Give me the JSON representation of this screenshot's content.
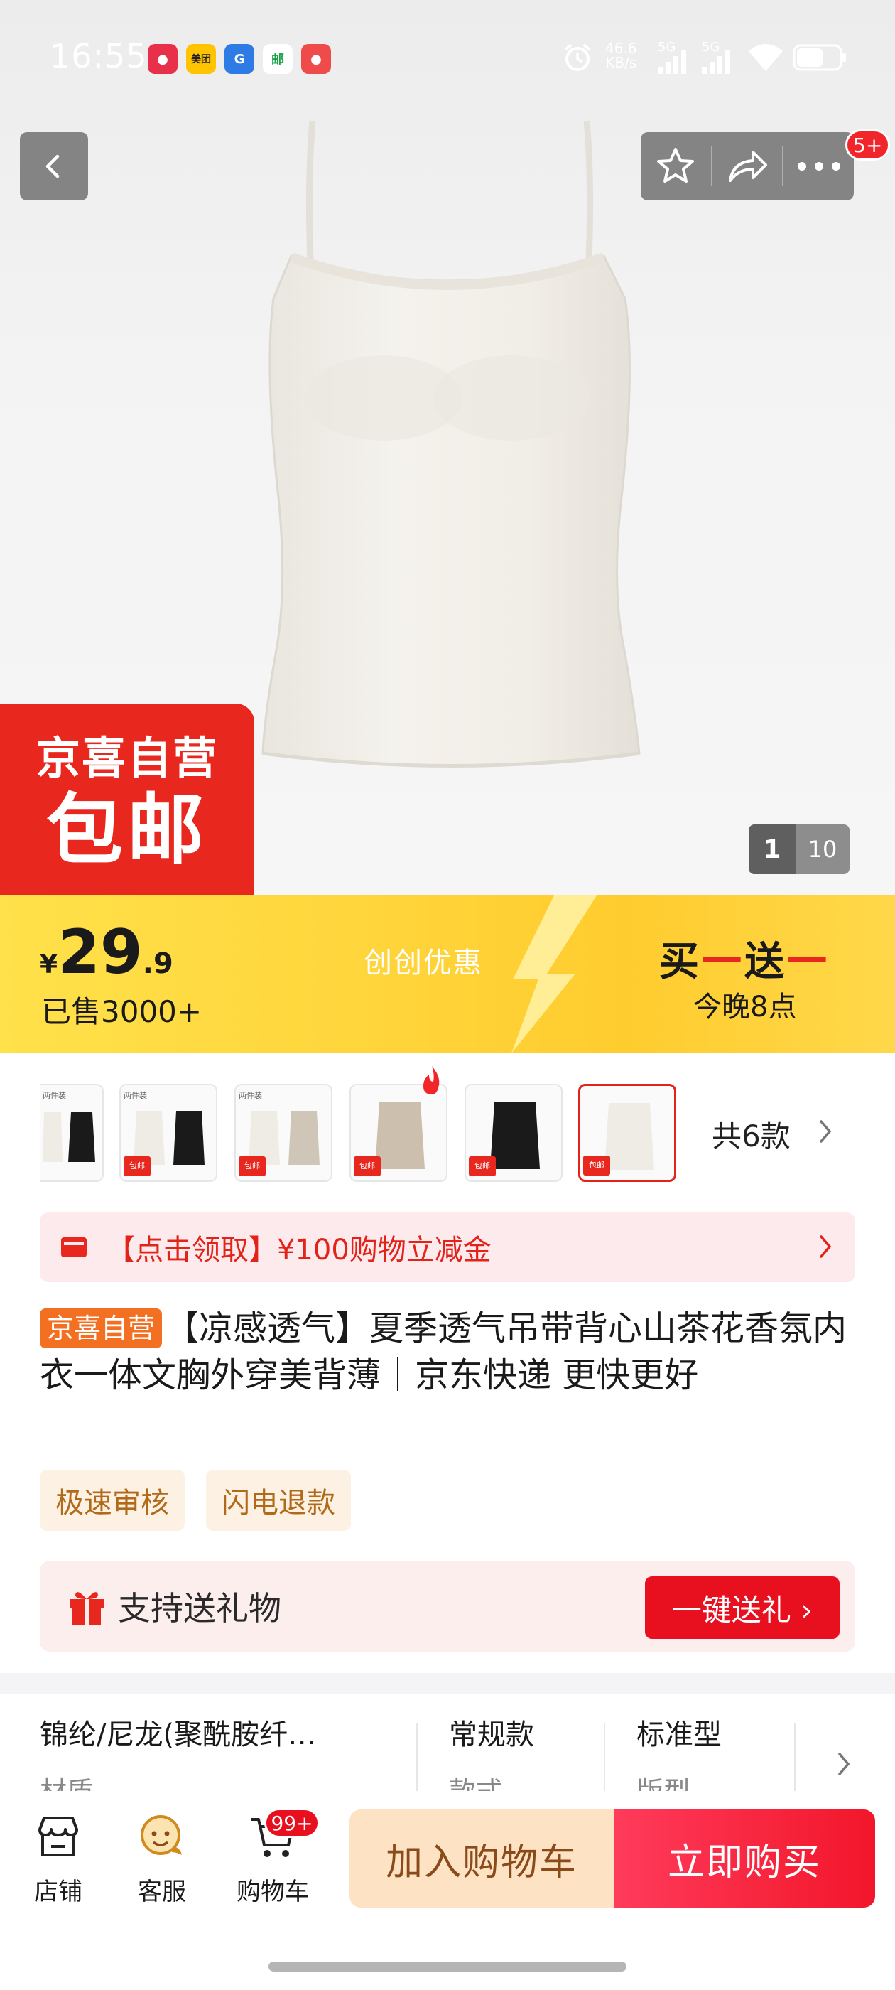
{
  "status_bar": {
    "time": "16:55",
    "network_speed": "46.6\nKB/s",
    "net_label_1": "5G",
    "net_label_2": "5G",
    "notification_apps": [
      "app-1-icon",
      "meituan-icon",
      "app-3-icon",
      "china-post-icon",
      "app-5-icon"
    ]
  },
  "top_bar": {
    "notification_badge": "5+"
  },
  "hero": {
    "promo_tag_line1": "京喜自营",
    "promo_tag_line2": "包邮",
    "image_index": "1",
    "image_total": "10"
  },
  "promo_band": {
    "currency": "¥",
    "price_int": "29",
    "price_dec": ".9",
    "sold": "已售3000+",
    "middle_label": "创创优惠",
    "deal_a": "买",
    "deal_dash": "一",
    "deal_b": "送",
    "deal_time": "今晚8点"
  },
  "variants": {
    "thumb_label": "两件装",
    "thumb_mini_tag": "包邮",
    "more_label": "共6款"
  },
  "coupon": {
    "text": "【点击领取】¥100购物立减金"
  },
  "product": {
    "tag": "京喜自营",
    "title": "【凉感透气】夏季透气吊带背心山茶花香氛内衣一体文胸外穿美背薄｜京东快递 更快更好",
    "chips": [
      "极速审核",
      "闪电退款"
    ]
  },
  "gift": {
    "label": "支持送礼物",
    "button": "一键送礼 ›"
  },
  "specs": [
    {
      "value": "锦纶/尼龙(聚酰胺纤…",
      "key": "材质"
    },
    {
      "value": "常规款",
      "key": "款式"
    },
    {
      "value": "标准型",
      "key": "版型"
    }
  ],
  "bottom_nav": {
    "store": "店铺",
    "service": "客服",
    "cart": "购物车",
    "cart_badge": "99+",
    "add_to_cart": "加入购物车",
    "buy_now": "立即购买"
  },
  "colors": {
    "brand_red": "#e2231a",
    "promo_yellow": "#ffd43a",
    "jx_orange": "#f36f21"
  }
}
